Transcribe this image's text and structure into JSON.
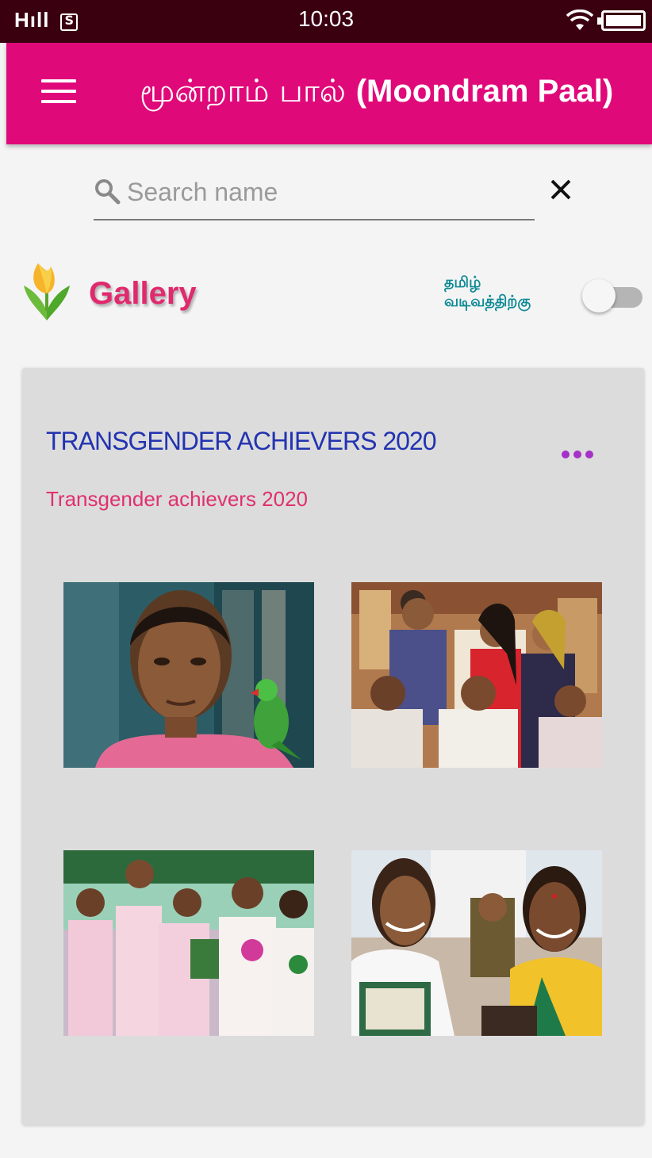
{
  "status_bar": {
    "signal": "Hıll",
    "time": "10:03"
  },
  "app_bar": {
    "title_tamil": "மூன்றாம் பால் ",
    "title_latin": "(Moondram Paal)"
  },
  "search": {
    "placeholder": "Search name",
    "value": ""
  },
  "gallery": {
    "title": "Gallery",
    "language_toggle_label_line1": "தமிழ்",
    "language_toggle_label_line2": "வடிவத்திற்கு",
    "language_toggle_on": false
  },
  "album": {
    "title": "TRANSGENDER ACHIEVERS 2020",
    "subtitle": "Transgender achievers 2020",
    "photos": [
      {
        "name": "photo-woman-with-parrot"
      },
      {
        "name": "photo-group-award"
      },
      {
        "name": "photo-nurses-ceremony"
      },
      {
        "name": "photo-doctors-certificates"
      }
    ]
  },
  "colors": {
    "status_bar": "#3b0010",
    "app_bar": "#e0097a",
    "album_title": "#2233b0",
    "album_subtitle": "#e0306e",
    "gallery_title": "#e02a6e",
    "toggle_label": "#0d8a95",
    "more_dots": "#a531c8"
  },
  "icons": {
    "menu": "hamburger-menu-icon",
    "search": "search-icon",
    "clear": "close-icon",
    "more": "more-horizontal-icon",
    "logo": "tulip-logo-icon",
    "wifi": "wifi-icon",
    "battery": "battery-icon",
    "sim": "sim-icon"
  }
}
